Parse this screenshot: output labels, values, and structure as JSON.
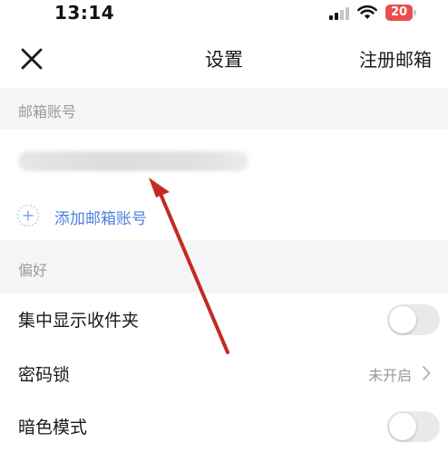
{
  "status_bar": {
    "time": "13:14",
    "battery_level": "20",
    "battery_color": "#e84e4e",
    "signal_bars_active": 2,
    "signal_bars_total": 4
  },
  "nav": {
    "close_icon": "close-icon",
    "title": "设置",
    "register_label": "注册邮箱"
  },
  "accounts": {
    "section_title": "邮箱账号",
    "add_label": "添加邮箱账号",
    "add_icon": "plus-circle-icon",
    "accent_color": "#4f7fe0"
  },
  "preferences": {
    "section_title": "偏好",
    "items": [
      {
        "label": "集中显示收件夹",
        "type": "toggle",
        "on": false
      },
      {
        "label": "密码锁",
        "type": "link",
        "value": "未开启"
      },
      {
        "label": "暗色模式",
        "type": "toggle",
        "on": false
      }
    ]
  },
  "annotation": {
    "arrow_color": "#c42a23"
  }
}
